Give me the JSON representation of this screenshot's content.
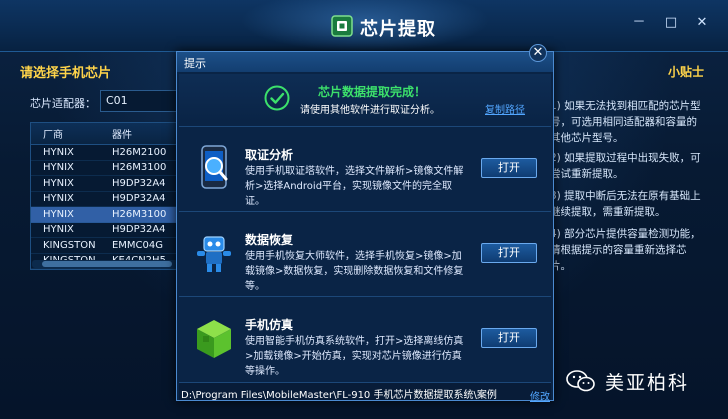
{
  "app": {
    "title": "芯片提取"
  },
  "window_controls": {
    "minimize": "－",
    "maximize": "□",
    "close": "✕"
  },
  "left_panel": {
    "title": "请选择手机芯片",
    "adapter_label": "芯片适配器：",
    "adapter_value": "C01",
    "table": {
      "headers": [
        "厂商",
        "器件"
      ],
      "rows": [
        [
          "HYNIX",
          "H26M2100"
        ],
        [
          "HYNIX",
          "H26M3100"
        ],
        [
          "HYNIX",
          "H9DP32A4"
        ],
        [
          "HYNIX",
          "H9DP32A4"
        ],
        [
          "HYNIX",
          "H26M3100"
        ],
        [
          "HYNIX",
          "H9DP32A4"
        ],
        [
          "KINGSTON",
          "EMMC04G"
        ],
        [
          "KINGSTON",
          "KE4CN2H5"
        ]
      ],
      "selected_index": 4
    }
  },
  "tips": {
    "title": "小贴士",
    "items": [
      "1) 如果无法找到相匹配的芯片型号，可选用相同适配器和容量的其他芯片型号。",
      "2) 如果提取过程中出现失败，可尝试重新提取。",
      "3) 提取中断后无法在原有基础上继续提取，需重新提取。",
      "4) 部分芯片提供容量检测功能，请根据提示的容量重新选择芯片。"
    ]
  },
  "dialog": {
    "title": "提示",
    "close_label": "✕",
    "success_title": "芯片数据提取完成！",
    "success_sub": "请使用其他软件进行取证分析。",
    "copy_link": "复制路径",
    "sections": [
      {
        "title": "取证分析",
        "desc": "使用手机取证塔软件，选择文件解析>镜像文件解析>选择Android平台，实现镜像文件的完全取证。",
        "button": "打开"
      },
      {
        "title": "数据恢复",
        "desc": "使用手机恢复大师软件，选择手机恢复>镜像>加载镜像>数据恢复，实现删除数据恢复和文件修复等。",
        "button": "打开"
      },
      {
        "title": "手机仿真",
        "desc": "使用智能手机仿真系统软件，打开>选择离线仿真>加载镜像>开始仿真，实现对芯片镜像进行仿真等操作。",
        "button": "打开"
      }
    ],
    "path": "D:\\Program Files\\MobileMaster\\FL-910 手机芯片数据提取系统\\案例",
    "modify_link": "修改"
  },
  "watermark": {
    "text": "美亚柏科",
    "icon": "wechat-icon"
  },
  "colors": {
    "accent": "#ffd44a",
    "success": "#3ce06b",
    "link": "#52a6ff",
    "selected_row": "#3160a6"
  }
}
